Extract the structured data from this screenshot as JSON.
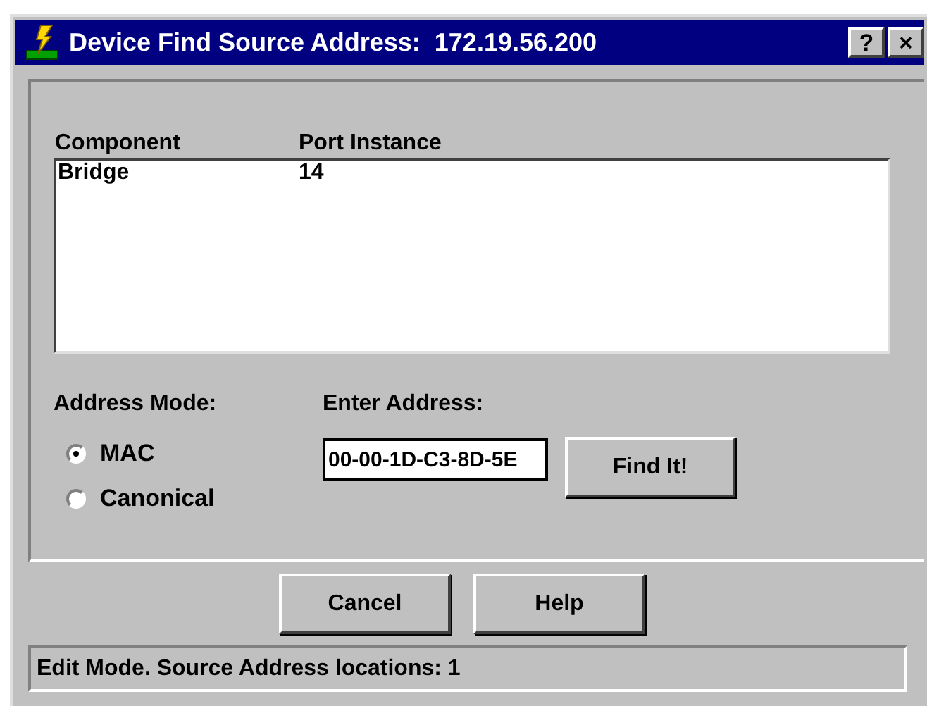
{
  "window": {
    "title": "Device Find Source Address:  172.19.56.200",
    "buttons": [
      "?",
      "×"
    ]
  },
  "table": {
    "columns": [
      "Component",
      "Port Instance"
    ],
    "rows": [
      [
        "Bridge",
        "14"
      ]
    ]
  },
  "address_mode": {
    "label": "Address Mode:",
    "options": [
      {
        "label": "MAC",
        "selected": true
      },
      {
        "label": "Canonical",
        "selected": false
      }
    ]
  },
  "address": {
    "label": "Enter Address:",
    "value": "00-00-1D-C3-8D-5E"
  },
  "find_button": "Find It!",
  "buttons": [
    "Cancel",
    "Help"
  ],
  "status_bar": "Edit Mode. Source Address locations: 1"
}
